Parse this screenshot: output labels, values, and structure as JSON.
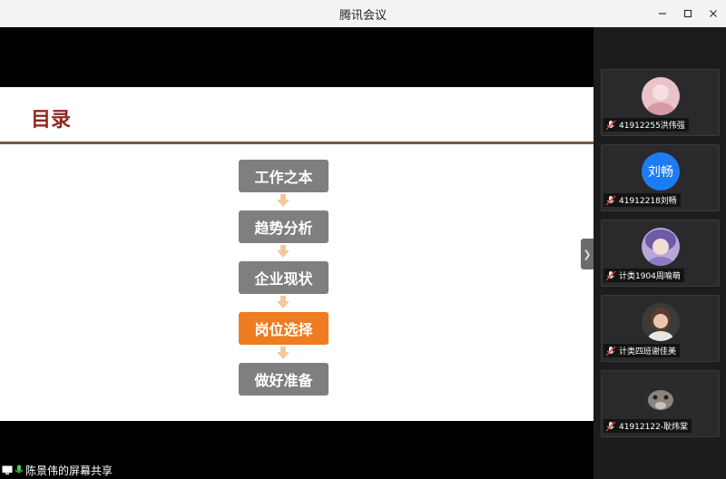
{
  "window": {
    "title": "腾讯会议",
    "minimize_icon": "minimize-icon",
    "maximize_icon": "maximize-icon",
    "close_icon": "close-icon"
  },
  "slide": {
    "title": "目录",
    "steps": [
      {
        "label": "工作之本",
        "active": false
      },
      {
        "label": "趋势分析",
        "active": false
      },
      {
        "label": "企业现状",
        "active": false
      },
      {
        "label": "岗位选择",
        "active": true
      },
      {
        "label": "做好准备",
        "active": false
      }
    ]
  },
  "participants": [
    {
      "name": "41912255洪伟强",
      "avatar": "photo-pink"
    },
    {
      "name": "41912218刘畅",
      "avatar_text": "刘畅"
    },
    {
      "name": "计类1904周喻萌",
      "avatar": "photo-anime"
    },
    {
      "name": "计类四班谢佳美",
      "avatar": "photo-person"
    },
    {
      "name": "41912122-耿炜棠",
      "avatar": "photo-cat"
    }
  ],
  "status": {
    "share_text": "陈景伟的屏幕共享"
  },
  "colors": {
    "slide_title": "#8c2b20",
    "step_default": "#7f7f7f",
    "step_active": "#ee7c20",
    "arrow": "#f6c79c",
    "letter_avatar": "#1c7cf4"
  }
}
